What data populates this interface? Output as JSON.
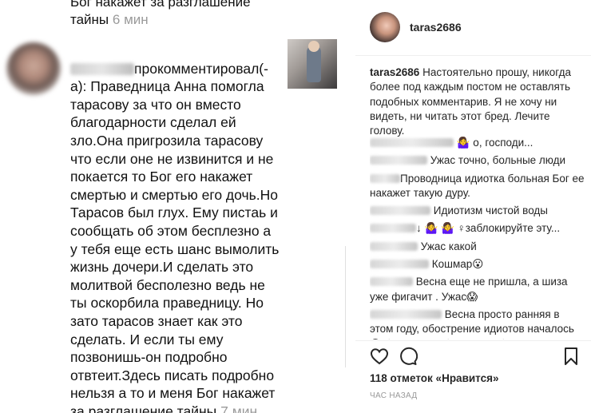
{
  "left_panel": {
    "top_fragment_text": "Бог накажет за разглашение\nтайны ",
    "top_fragment_time": "6 мин",
    "comment_action": "прокомментировал(-а): ",
    "comment_body": "Праведница Анна помогла тарасову за что он вместо благодарности сделал ей зло.Она пригрозила тарасову что если оне не извинится и не покается то Бог его накажет смертью и смертью его дочь.Но Тарасов был глух. Ему пистаь и сообщать об этом бесплезно а у тебя еще есть шанс вымолить жизнь дочери.И сделать это молитвой бесполезно ведь не ты оскорбила праведницу. Но зато тарасов знает как это сделать. И если ты ему позвонишь-он подробно отвтеит.Здесь писать подробно нельзя а то и меня Бог накажет за разглашение тайны ",
    "comment_time": "7 мин"
  },
  "post": {
    "username": "taras2686",
    "caption_user": "taras2686",
    "caption_text": " Настоятельно прошу, никогда более под каждым постом не оставлять подобных комментарив. Я не хочу ни видеть, ни читать этот бред. Лечите голову.",
    "comments": [
      {
        "text": " 🤷‍♀️ о, господи..."
      },
      {
        "text": " Ужас точно, больные люди"
      },
      {
        "text": "Проводница идиотка больная Бог ее накажет такую дуру."
      },
      {
        "text": " Идиотизм чистой воды"
      },
      {
        "text": "↓ 🤷‍♀️ 🤷‍♀️ ♀заблокируйте эту..."
      },
      {
        "text": " Ужас какой"
      },
      {
        "text": " Кошмар😮"
      },
      {
        "text": " Весна еще не пришла, а шиза уже фигачит . Ужас😱"
      },
      {
        "text": " Весна просто ранняя в этом году, обострение идиотов началось 😮 берегите себя и своих близких"
      }
    ],
    "likes_text": "118 отметок «Нравится»",
    "time_ago": "ЧАС НАЗАД"
  },
  "icons": {
    "like": "heart-icon",
    "comment": "comment-bubble-icon",
    "save": "bookmark-icon"
  },
  "colors": {
    "timestamp": "#9a9a9a",
    "text": "#262626"
  }
}
